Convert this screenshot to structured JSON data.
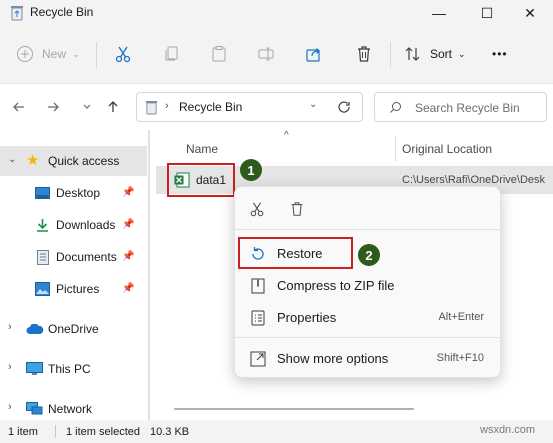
{
  "window": {
    "title": "Recycle Bin",
    "minimize_glyph": "—",
    "maximize_glyph": "☐",
    "close_glyph": "✕"
  },
  "toolbar": {
    "new_label": "New",
    "sort_label": "Sort",
    "more_label": "•••"
  },
  "address": {
    "path": "Recycle Bin",
    "search_placeholder": "Search Recycle Bin"
  },
  "sidebar": {
    "items": [
      {
        "label": "Quick access",
        "icon": "star-icon",
        "selected": true
      },
      {
        "label": "Desktop",
        "icon": "desktop-icon",
        "pinned": true
      },
      {
        "label": "Downloads",
        "icon": "download-icon",
        "pinned": true
      },
      {
        "label": "Documents",
        "icon": "documents-icon",
        "pinned": true
      },
      {
        "label": "Pictures",
        "icon": "pictures-icon",
        "pinned": true
      },
      {
        "label": "OneDrive",
        "icon": "cloud-icon"
      },
      {
        "label": "This PC",
        "icon": "computer-icon"
      },
      {
        "label": "Network",
        "icon": "network-icon"
      }
    ]
  },
  "columns": {
    "name": "Name",
    "original_location": "Original Location"
  },
  "file": {
    "name": "data1",
    "location": "C:\\Users\\Rafi\\OneDrive\\Desk"
  },
  "context_menu": {
    "restore": "Restore",
    "compress": "Compress to ZIP file",
    "properties": "Properties",
    "properties_shortcut": "Alt+Enter",
    "more_options": "Show more options",
    "more_options_shortcut": "Shift+F10"
  },
  "steps": {
    "one": "1",
    "two": "2"
  },
  "status": {
    "item_count": "1 item",
    "selected": "1 item selected",
    "size": "10.3 KB"
  },
  "watermark": "wsxdn.com",
  "colors": {
    "highlight_box": "#cc1f1f",
    "step_badge": "#2e5a1c",
    "accent_blue": "#1a73c8",
    "excel_green": "#1d7a43"
  }
}
